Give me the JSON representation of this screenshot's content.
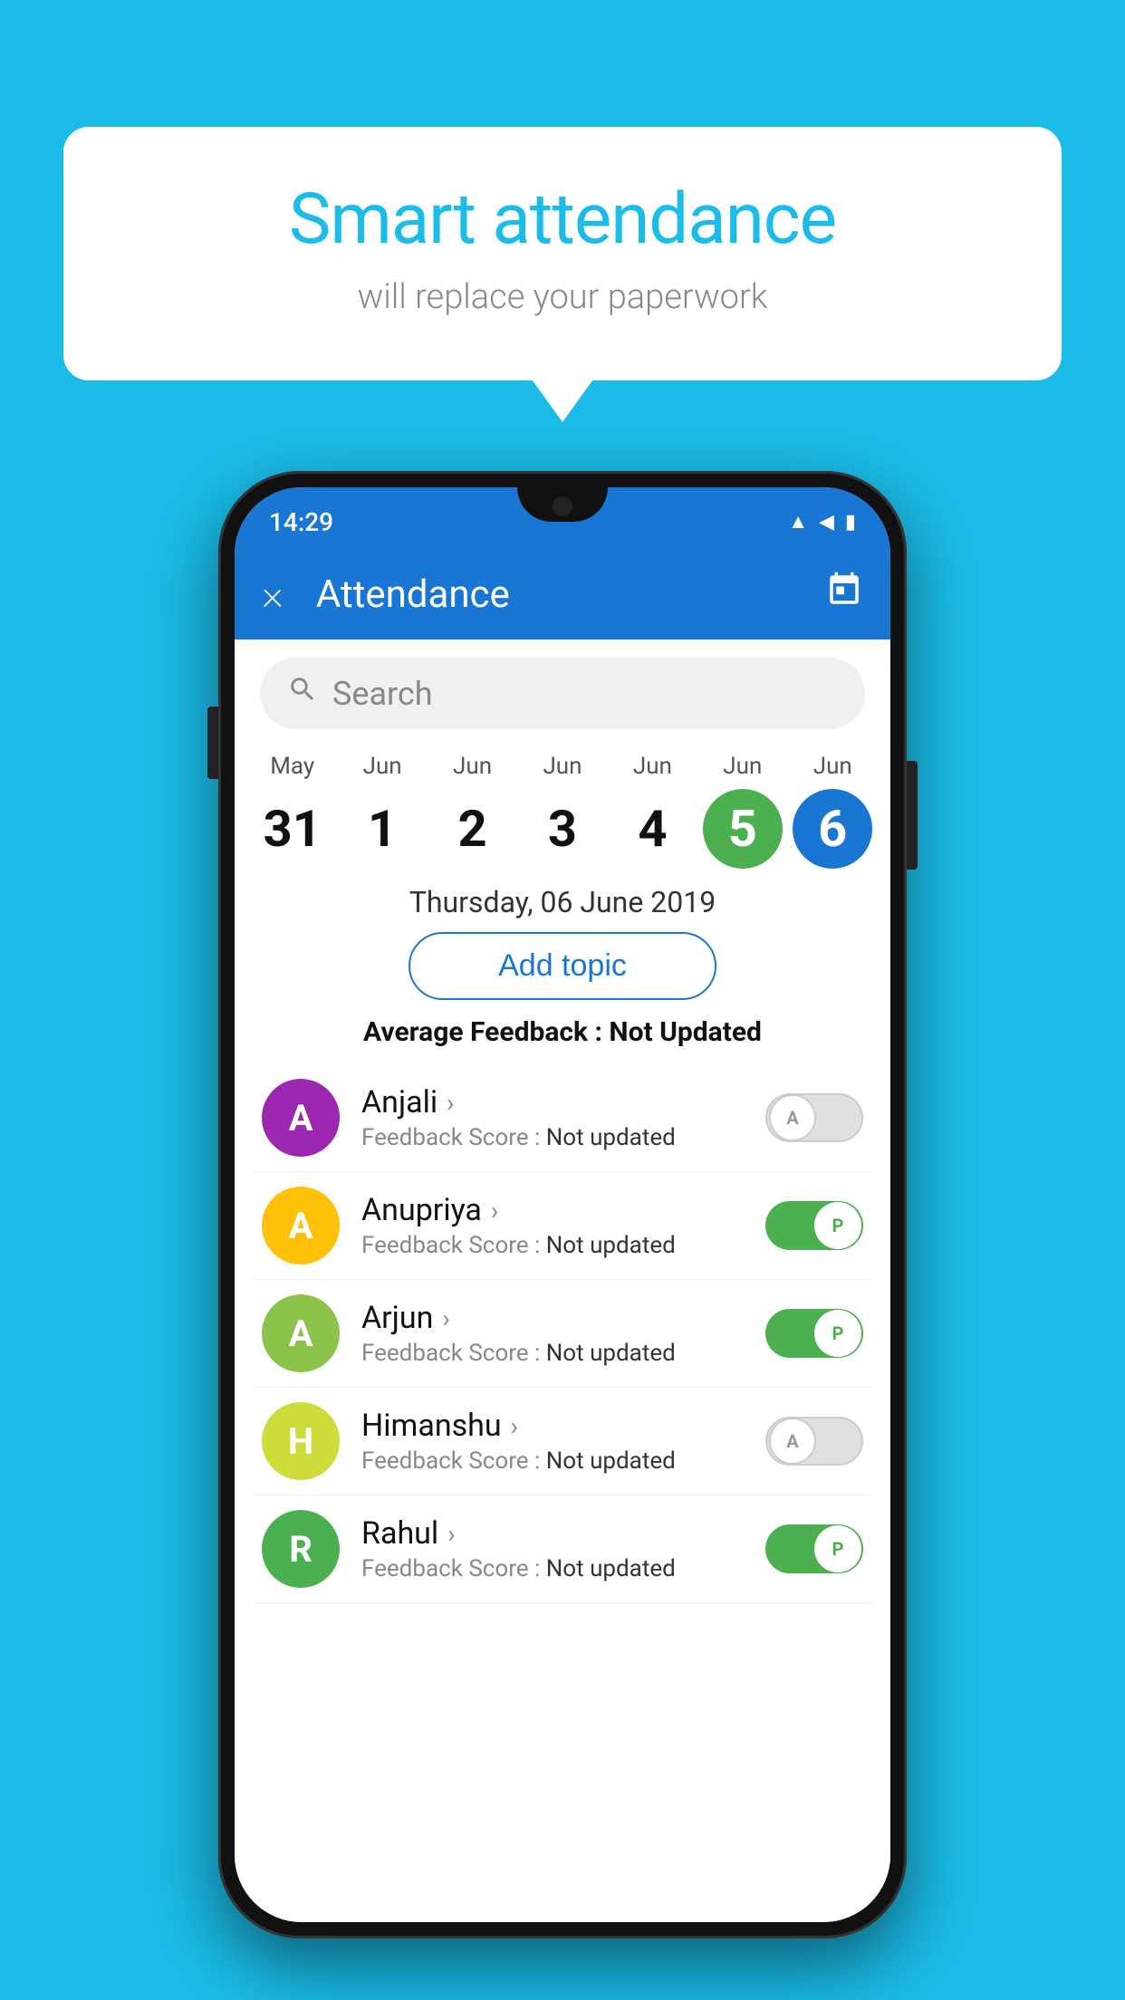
{
  "background_color": "#1BBDE8",
  "speech_bubble": {
    "title": "Smart attendance",
    "subtitle": "will replace your paperwork"
  },
  "status_bar": {
    "time": "14:29",
    "icons": [
      "wifi",
      "signal",
      "battery"
    ]
  },
  "app_bar": {
    "title": "Attendance",
    "close_label": "×",
    "calendar_icon": "📅"
  },
  "search": {
    "placeholder": "Search"
  },
  "calendar": {
    "days": [
      {
        "month": "May",
        "num": "31",
        "state": "normal"
      },
      {
        "month": "Jun",
        "num": "1",
        "state": "normal"
      },
      {
        "month": "Jun",
        "num": "2",
        "state": "normal"
      },
      {
        "month": "Jun",
        "num": "3",
        "state": "normal"
      },
      {
        "month": "Jun",
        "num": "4",
        "state": "normal"
      },
      {
        "month": "Jun",
        "num": "5",
        "state": "today"
      },
      {
        "month": "Jun",
        "num": "6",
        "state": "selected"
      }
    ]
  },
  "selected_date": "Thursday, 06 June 2019",
  "add_topic_label": "Add topic",
  "avg_feedback_label": "Average Feedback : ",
  "avg_feedback_value": "Not Updated",
  "students": [
    {
      "name": "Anjali",
      "initial": "A",
      "avatar_color": "#9C27B0",
      "feedback_label": "Feedback Score : ",
      "feedback_value": "Not updated",
      "toggle_state": "off",
      "toggle_char": "A"
    },
    {
      "name": "Anupriya",
      "initial": "A",
      "avatar_color": "#FFC107",
      "feedback_label": "Feedback Score : ",
      "feedback_value": "Not updated",
      "toggle_state": "on",
      "toggle_char": "P"
    },
    {
      "name": "Arjun",
      "initial": "A",
      "avatar_color": "#8BC34A",
      "feedback_label": "Feedback Score : ",
      "feedback_value": "Not updated",
      "toggle_state": "on",
      "toggle_char": "P"
    },
    {
      "name": "Himanshu",
      "initial": "H",
      "avatar_color": "#CDDC39",
      "feedback_label": "Feedback Score : ",
      "feedback_value": "Not updated",
      "toggle_state": "off",
      "toggle_char": "A"
    },
    {
      "name": "Rahul",
      "initial": "R",
      "avatar_color": "#4CAF50",
      "feedback_label": "Feedback Score : ",
      "feedback_value": "Not updated",
      "toggle_state": "on",
      "toggle_char": "P"
    }
  ]
}
